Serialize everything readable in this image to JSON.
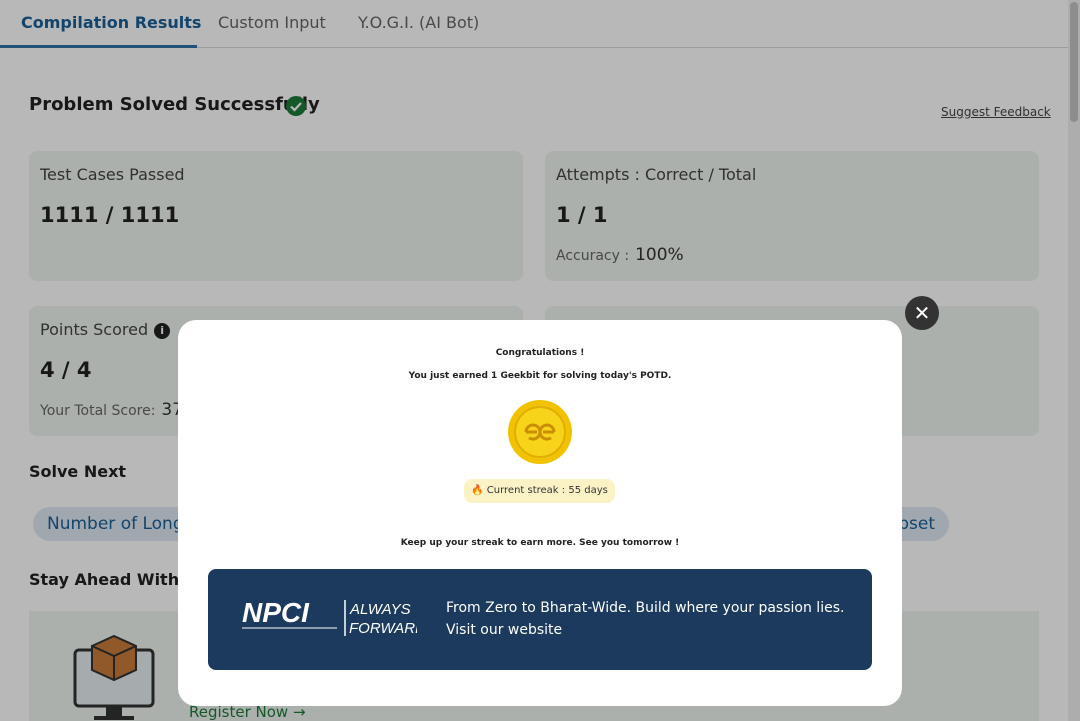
{
  "tabs": [
    {
      "label": "Compilation Results",
      "active": true
    },
    {
      "label": "Custom Input",
      "active": false
    },
    {
      "label": "Y.O.G.I. (AI Bot)",
      "active": false
    }
  ],
  "result": {
    "title": "Problem Solved Successfully",
    "feedback_link": "Suggest Feedback"
  },
  "cards": {
    "test_cases": {
      "label": "Test Cases Passed",
      "value": "1111 / 1111"
    },
    "attempts": {
      "label": "Attempts : Correct / Total",
      "value": "1 / 1",
      "sub_label": "Accuracy :",
      "sub_value": "100%"
    },
    "points": {
      "label": "Points Scored",
      "value": "4 / 4",
      "sub_label": "Your Total Score:",
      "sub_value": "37"
    }
  },
  "solve_next": {
    "heading": "Solve Next",
    "items": [
      "Number of Longe",
      "bset"
    ]
  },
  "stay_ahead": {
    "heading": "Stay Ahead With:",
    "register_label": "Register Now →"
  },
  "modal": {
    "congrats": "Congratulations !",
    "earned": "You just earned 1 Geekbit for solving today's POTD.",
    "streak": "🔥 Current streak : 55 days",
    "keep_up": "Keep up your streak to earn more. See you tomorrow !",
    "close_icon": "✕"
  },
  "banner": {
    "logo_text": "NPCI",
    "logo_tagline_top": "ALWAYS",
    "logo_tagline_bottom": "FORWARD",
    "text": "From Zero to Bharat-Wide. Build where your passion lies. Visit our website"
  },
  "colors": {
    "accent": "#1b5f96",
    "success": "#1e7a3a",
    "banner_bg": "#1b3a5d",
    "coin": "#f2c200"
  }
}
